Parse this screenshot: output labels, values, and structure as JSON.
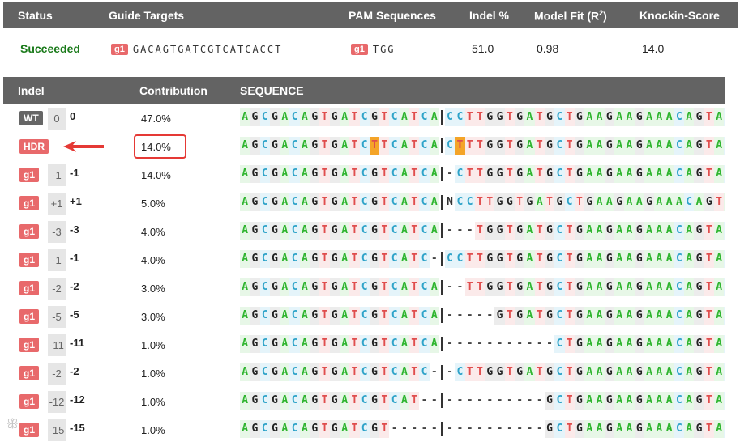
{
  "summary": {
    "headers": {
      "status": "Status",
      "guide_targets": "Guide Targets",
      "pam_sequences": "PAM Sequences",
      "indel_pct": "Indel %",
      "model_fit": "Model Fit (R",
      "model_fit_sup": "2",
      "model_fit_close": ")",
      "knockin": "Knockin-Score"
    },
    "row": {
      "status": "Succeeded",
      "guide_tag": "g1",
      "guide_seq": "GACAGTGATCGTCATCACCT",
      "pam_tag": "g1",
      "pam_seq": "TGG",
      "indel": "51.0",
      "model_fit": "0.98",
      "knockin": "14.0"
    }
  },
  "alleles": {
    "headers": {
      "indel": "Indel",
      "contribution": "Contribution",
      "sequence": "SEQUENCE"
    },
    "rows": [
      {
        "label": "WT",
        "kind": "wt",
        "num": "0",
        "num_bold": "0",
        "contribution": "47.0%",
        "left": "AGCGACAGTGATCGTCATCA",
        "right": "CCTTGGTGATGCTGAAGAAGAAACAGTACACATC",
        "left_mut": [],
        "right_mut": [],
        "gap_cut": false
      },
      {
        "label": "HDR",
        "kind": "hdr",
        "num": "",
        "num_bold": "",
        "contribution": "14.0%",
        "left": "AGCGACAGTGATCTTCATCA",
        "right": "CTTTGGTGATGCTGAAGAAGAAACAGTACACATC",
        "left_mut": [
          13
        ],
        "right_mut": [
          1
        ],
        "gap_cut": false
      },
      {
        "label": "g1",
        "kind": "g",
        "num": "-1",
        "num_bold": "-1",
        "contribution": "14.0%",
        "left": "AGCGACAGTGATCGTCATCA",
        "right": "-CTTGGTGATGCTGAAGAAGAAACAGTACACATC",
        "left_mut": [],
        "right_mut": [],
        "gap_cut": false
      },
      {
        "label": "g1",
        "kind": "g",
        "num": "+1",
        "num_bold": "+1",
        "contribution": "5.0%",
        "left": "AGCGACAGTGATCGTCATCA",
        "right": "NCCTTGGTGATGCTGAAGAAGAAACAGTACACAT",
        "left_mut": [],
        "right_mut": [],
        "gap_cut": false
      },
      {
        "label": "g1",
        "kind": "g",
        "num": "-3",
        "num_bold": "-3",
        "contribution": "4.0%",
        "left": "AGCGACAGTGATCGTCATCA",
        "right": "---TGGTGATGCTGAAGAAGAAACAGTACACATC",
        "left_mut": [],
        "right_mut": [],
        "gap_cut": false
      },
      {
        "label": "g1",
        "kind": "g",
        "num": "-1",
        "num_bold": "-1",
        "contribution": "4.0%",
        "left": "AGCGACAGTGATCGTCATC-",
        "right": "CCTTGGTGATGCTGAAGAAGAAACAGTACACATC",
        "left_mut": [],
        "right_mut": [],
        "gap_cut": false
      },
      {
        "label": "g1",
        "kind": "g",
        "num": "-2",
        "num_bold": "-2",
        "contribution": "3.0%",
        "left": "AGCGACAGTGATCGTCATCA",
        "right": "--TTGGTGATGCTGAAGAAGAAACAGTACACATC",
        "left_mut": [],
        "right_mut": [],
        "gap_cut": false
      },
      {
        "label": "g1",
        "kind": "g",
        "num": "-5",
        "num_bold": "-5",
        "contribution": "3.0%",
        "left": "AGCGACAGTGATCGTCATCA",
        "right": "-----GTGATGCTGAAGAAGAAACAGTACACATC",
        "left_mut": [],
        "right_mut": [],
        "gap_cut": false
      },
      {
        "label": "g1",
        "kind": "g",
        "num": "-11",
        "num_bold": "-11",
        "contribution": "1.0%",
        "left": "AGCGACAGTGATCGTCATCA",
        "right": "-----------CTGAAGAAGAAACAGTACACATC",
        "left_mut": [],
        "right_mut": [],
        "gap_cut": false
      },
      {
        "label": "g1",
        "kind": "g",
        "num": "-2",
        "num_bold": "-2",
        "contribution": "1.0%",
        "left": "AGCGACAGTGATCGTCATC-",
        "right": "-CTTGGTGATGCTGAAGAAGAAACAGTACACATC",
        "left_mut": [],
        "right_mut": [],
        "gap_cut": false
      },
      {
        "label": "g1",
        "kind": "g",
        "num": "-12",
        "num_bold": "-12",
        "contribution": "1.0%",
        "left": "AGCGACAGTGATCGTCAT--",
        "right": "----------GCTGAAGAAGAAACAGTACACATC",
        "left_mut": [],
        "right_mut": [],
        "gap_cut": false
      },
      {
        "label": "g1",
        "kind": "g",
        "num": "-15",
        "num_bold": "-15",
        "contribution": "1.0%",
        "left": "AGCGACAGTGATCGT-----",
        "right": "----------GCTGAAGAAGAAACAGTACACATC",
        "left_mut": [],
        "right_mut": [],
        "gap_cut": false
      }
    ]
  },
  "highlight": {
    "row_index": 1,
    "box_color": "#e53935",
    "arrow_color": "#e53935"
  },
  "watermark": "大鹏跨境",
  "colors": {
    "header_bg": "#636363",
    "succeeded": "#1a7a1a",
    "tag_red": "#e8696b",
    "tag_gray": "#666666"
  }
}
